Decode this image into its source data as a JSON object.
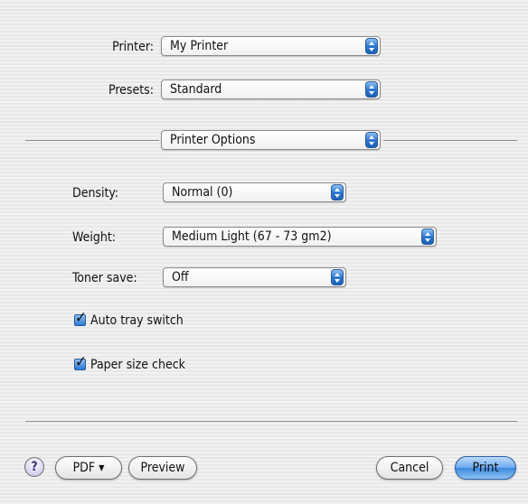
{
  "printer": {
    "label": "Printer:",
    "value": "My Printer"
  },
  "presets": {
    "label": "Presets:",
    "value": "Standard"
  },
  "panel_select": {
    "value": "Printer Options"
  },
  "options": {
    "density": {
      "label": "Density:",
      "value": "Normal (0)"
    },
    "weight": {
      "label": "Weight:",
      "value": "Medium Light (67 - 73 gm2)"
    },
    "toner_save": {
      "label": "Toner save:",
      "value": "Off"
    },
    "auto_tray_switch": {
      "label": "Auto tray switch",
      "checked": true
    },
    "paper_size_check": {
      "label": "Paper size check",
      "checked": true
    }
  },
  "footer": {
    "help_label": "?",
    "pdf_label": "PDF ▾",
    "preview_label": "Preview",
    "cancel_label": "Cancel",
    "print_label": "Print"
  },
  "icons": [
    "up-down-arrows-icon",
    "checkmark-icon",
    "help-icon"
  ],
  "colors": {
    "accent": "#2d79d2",
    "default_button": "#6aa9ee"
  }
}
